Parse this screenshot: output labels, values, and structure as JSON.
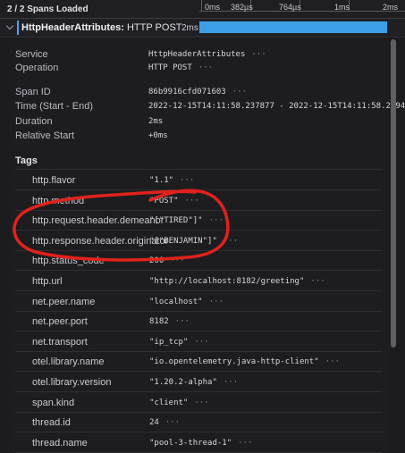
{
  "header": {
    "spans_loaded": "2 / 2 Spans Loaded",
    "ticks": [
      "0ms",
      "382µs",
      "764µs",
      "1ms",
      "2ms"
    ]
  },
  "span": {
    "service": "HttpHeaderAttributes:",
    "operation": "HTTP POST",
    "duration": "2ms",
    "bar_fill_fraction": 1.0,
    "bar_color": "#3d9ee8"
  },
  "details": {
    "service_label": "Service",
    "service_value": "HttpHeaderAttributes",
    "operation_label": "Operation",
    "operation_value": "HTTP POST",
    "span_id_label": "Span ID",
    "span_id_value": "86b9916cfd071603",
    "time_label": "Time (Start - End)",
    "time_value": "2022-12-15T14:11:58.237877 - 2022-12-15T14:11:58.239404",
    "duration_label": "Duration",
    "duration_value": "2ms",
    "relative_start_label": "Relative Start",
    "relative_start_value": "+0ms",
    "more_glyph": "···"
  },
  "tags": {
    "title": "Tags",
    "rows": [
      {
        "key": "http.flavor",
        "value": "\"1.1\""
      },
      {
        "key": "http.method",
        "value": "\"POST\""
      },
      {
        "key": "http.request.header.demeanor",
        "value": "\"[\"TIRED\"]\""
      },
      {
        "key": "http.response.header.originator",
        "value": "\"[\"BENJAMIN\"]\""
      },
      {
        "key": "http.status_code",
        "value": "200"
      },
      {
        "key": "http.url",
        "value": "\"http://localhost:8182/greeting\""
      },
      {
        "key": "net.peer.name",
        "value": "\"localhost\""
      },
      {
        "key": "net.peer.port",
        "value": "8182"
      },
      {
        "key": "net.transport",
        "value": "\"ip_tcp\""
      },
      {
        "key": "otel.library.name",
        "value": "\"io.opentelemetry.java-http-client\""
      },
      {
        "key": "otel.library.version",
        "value": "\"1.20.2-alpha\""
      },
      {
        "key": "span.kind",
        "value": "\"client\""
      },
      {
        "key": "thread.id",
        "value": "24"
      },
      {
        "key": "thread.name",
        "value": "\"pool-3-thread-1\""
      }
    ]
  },
  "colors": {
    "background": "#1b1b1d",
    "accent_blue": "#3d9ee8",
    "annotation_red": "#e0221b"
  }
}
